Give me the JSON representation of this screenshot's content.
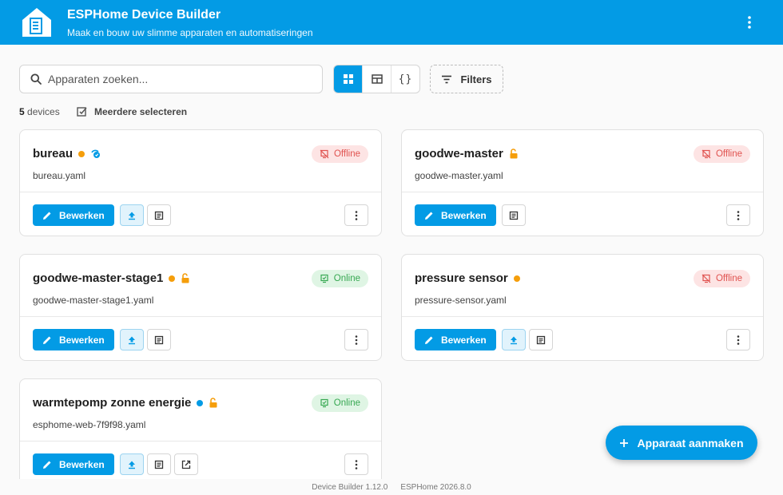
{
  "header": {
    "title": "ESPHome Device Builder",
    "subtitle": "Maak en bouw uw slimme apparaten en automatiseringen"
  },
  "search": {
    "placeholder": "Apparaten zoeken..."
  },
  "view_toggle": {
    "json_label": "{}"
  },
  "filters": {
    "label": "Filters"
  },
  "summary": {
    "count": "5",
    "count_unit": "devices",
    "multi_select": "Meerdere selecteren"
  },
  "cards": [
    {
      "name": "bureau",
      "file": "bureau.yaml",
      "status": "Offline",
      "edit": "Bewerken"
    },
    {
      "name": "goodwe-master",
      "file": "goodwe-master.yaml",
      "status": "Offline",
      "edit": "Bewerken"
    },
    {
      "name": "goodwe-master-stage1",
      "file": "goodwe-master-stage1.yaml",
      "status": "Online",
      "edit": "Bewerken"
    },
    {
      "name": "pressure sensor",
      "file": "pressure-sensor.yaml",
      "status": "Offline",
      "edit": "Bewerken"
    },
    {
      "name": "warmtepomp zonne energie",
      "file": "esphome-web-7f9f98.yaml",
      "status": "Online",
      "edit": "Bewerken"
    }
  ],
  "fab": {
    "label": "Apparaat aanmaken"
  },
  "footer": {
    "builder_version": "Device Builder 1.12.0",
    "esphome_version": "ESPHome 2026.8.0"
  },
  "colors": {
    "primary": "#039be5",
    "offline": "#e0524f",
    "online": "#37a852",
    "warning": "#f59e0b"
  }
}
